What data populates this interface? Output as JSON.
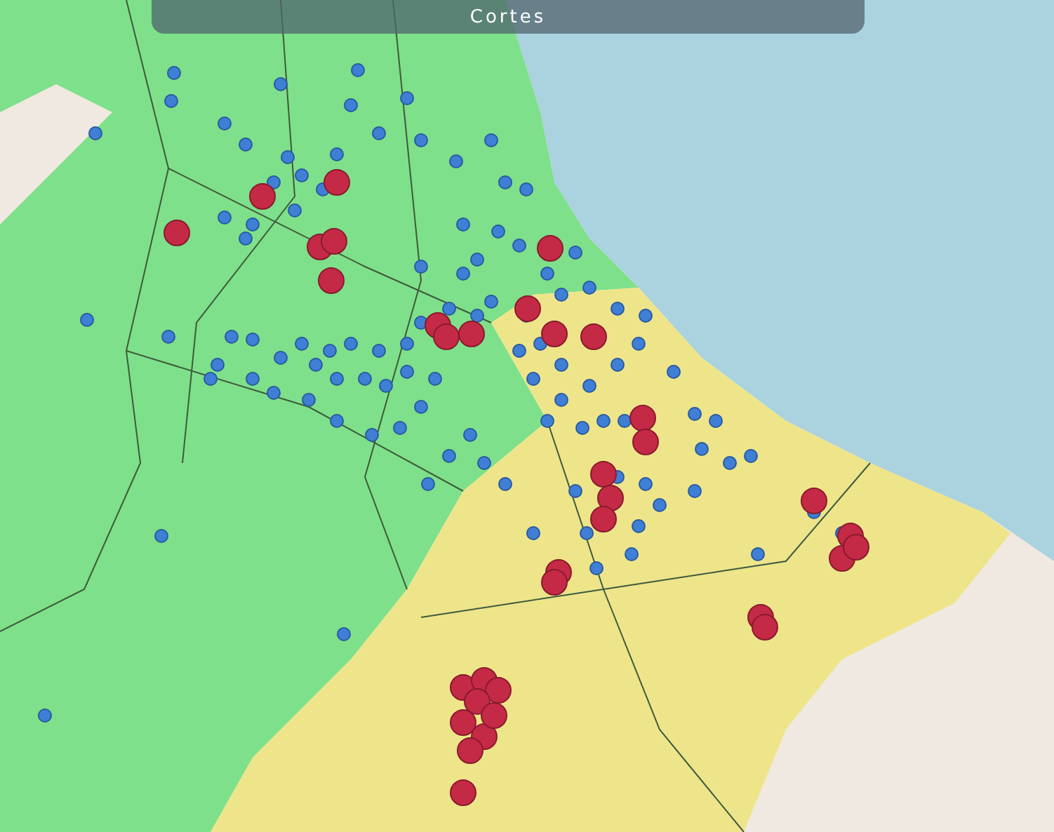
{
  "map": {
    "title": "Cortes"
  }
}
